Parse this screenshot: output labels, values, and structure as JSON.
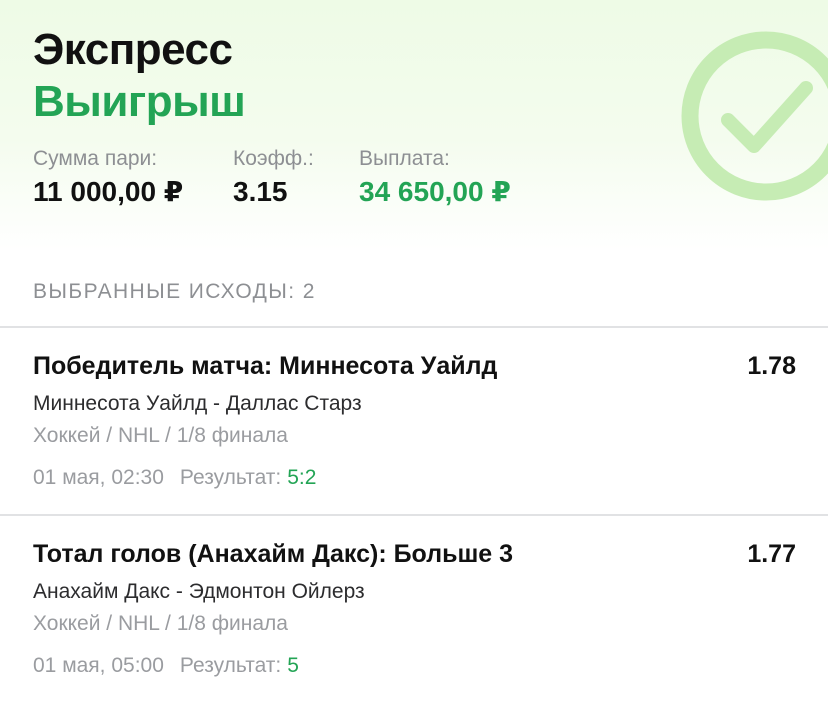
{
  "header": {
    "bet_type": "Экспресс",
    "status": "Выигрыш",
    "status_icon": "checkmark-circle-icon",
    "accent_color": "#23a455"
  },
  "summary": {
    "amount_label": "Сумма пари:",
    "amount_value": "11 000,00 ₽",
    "coef_label": "Коэфф.:",
    "coef_value": "3.15",
    "payout_label": "Выплата:",
    "payout_value": "34 650,00 ₽"
  },
  "outcomes": {
    "title": "ВЫБРАННЫЕ ИСХОДЫ: 2",
    "items": [
      {
        "name": "Победитель матча: Миннесота Уайлд",
        "odds": "1.78",
        "match": "Миннесота Уайлд - Даллас Старз",
        "league": "Хоккей / NHL / 1/8 финала",
        "datetime": "01 мая, 02:30",
        "result_label": "Результат:",
        "result_value": "5:2"
      },
      {
        "name": "Тотал голов (Анахайм Дакс): Больше 3",
        "odds": "1.77",
        "match": "Анахайм Дакс - Эдмонтон Ойлерз",
        "league": "Хоккей / NHL / 1/8 финала",
        "datetime": "01 мая, 05:00",
        "result_label": "Результат:",
        "result_value": "5"
      }
    ]
  }
}
